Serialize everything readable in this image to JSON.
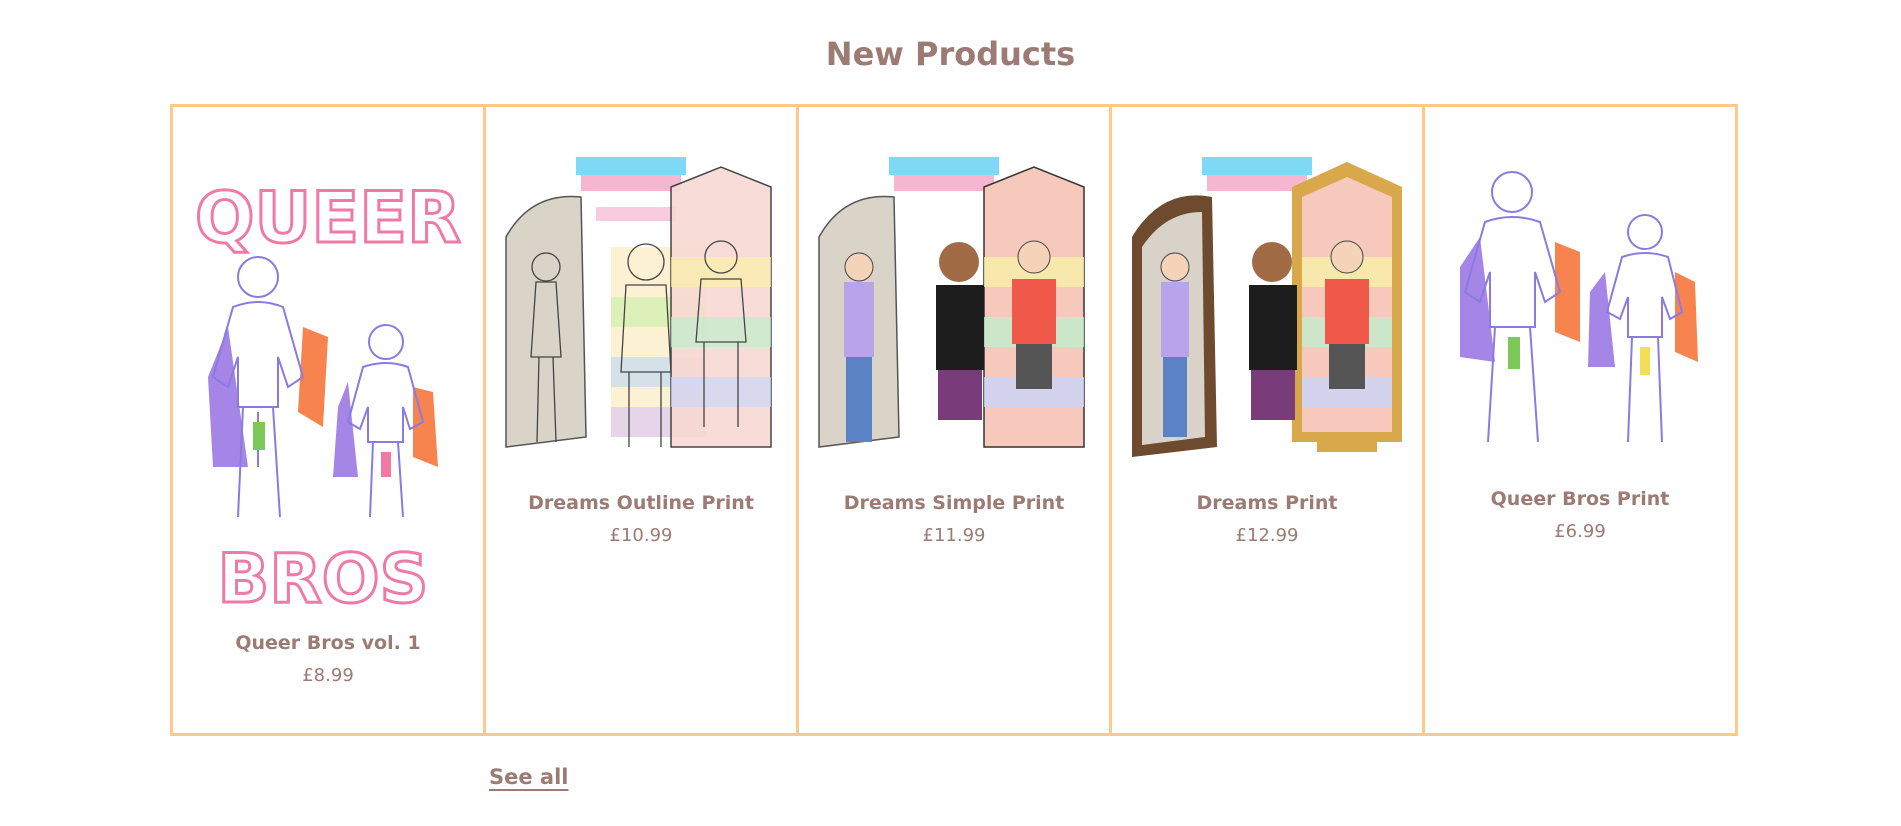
{
  "section": {
    "title": "New Products"
  },
  "products": [
    {
      "name": "Queer Bros vol. 1",
      "price": "£8.99",
      "image_icon": "queer-bros-cover-art",
      "cover_text_top": "QUEER",
      "cover_text_bottom": "BROS"
    },
    {
      "name": "Dreams Outline Print",
      "price": "£10.99",
      "image_icon": "dreams-outline-art"
    },
    {
      "name": "Dreams Simple Print",
      "price": "£11.99",
      "image_icon": "dreams-simple-art"
    },
    {
      "name": "Dreams Print",
      "price": "£12.99",
      "image_icon": "dreams-art"
    },
    {
      "name": "Queer Bros Print",
      "price": "£6.99",
      "image_icon": "queer-bros-art"
    }
  ],
  "footer": {
    "see_all_label": "See all"
  },
  "colors": {
    "text": "#9b7b73",
    "border": "#ffc98a",
    "pink": "#f07aa6",
    "purple_line": "#8a7be0"
  }
}
